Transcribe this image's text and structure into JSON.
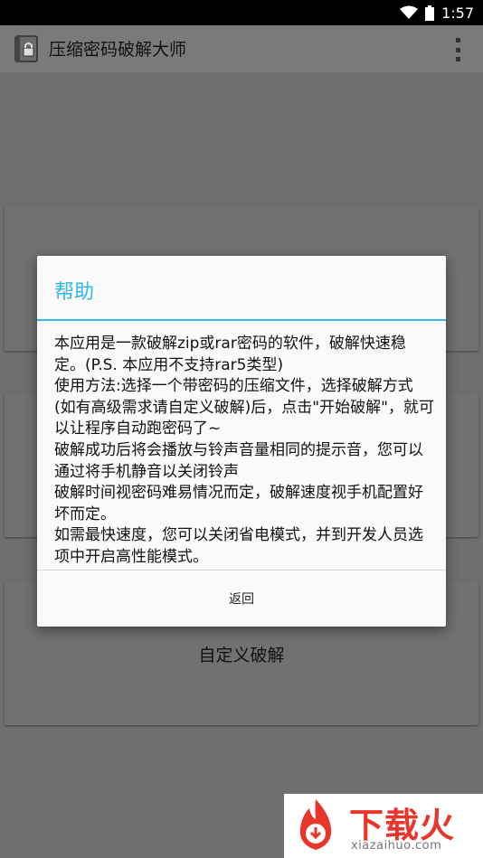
{
  "status_bar": {
    "time": "1:57"
  },
  "app_bar": {
    "title": "压缩密码破解大师"
  },
  "main": {
    "buttons": [
      {
        "label": ""
      },
      {
        "label": ""
      },
      {
        "label": "自定义破解"
      }
    ]
  },
  "dialog": {
    "title": "帮助",
    "body": "本应用是一款破解zip或rar密码的软件，破解快速稳定。(P.S. 本应用不支持rar5类型)\n使用方法:选择一个带密码的压缩文件，选择破解方式(如有高级需求请自定义破解)后，点击\"开始破解\"，就可以让程序自动跑密码了~\n破解成功后将会播放与铃声音量相同的提示音，您可以通过将手机静音以关闭铃声\n破解时间视密码难易情况而定，破解速度视手机配置好坏而定。\n如需最快速度，您可以关闭省电模式，并到开发人员选项中开启高性能模式。",
    "button": "返回"
  },
  "watermark": {
    "brand": "下载火",
    "domain": "xiazaihuo.com"
  },
  "colors": {
    "accent": "#33b5e5",
    "watermark": "#e8362a"
  }
}
